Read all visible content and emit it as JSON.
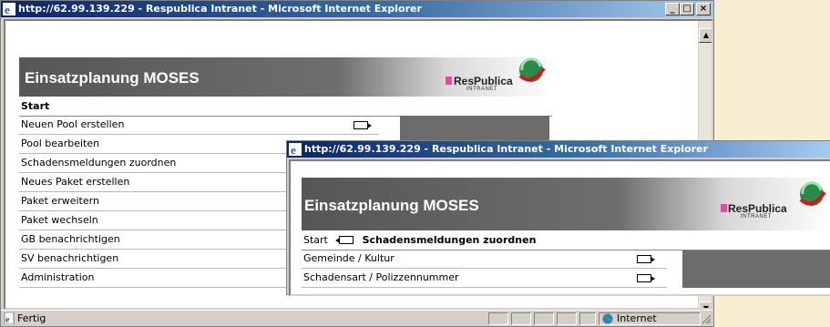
{
  "window_back": {
    "title": "http://62.99.139.229 - Respublica Intranet - Microsoft Internet Explorer",
    "controls": {
      "minimize": "_",
      "maximize": "□",
      "close": "×"
    },
    "banner_title": "Einsatzplanung MOSES",
    "logo": {
      "name": "ResPublica",
      "sub": "INTRANET"
    },
    "breadcrumb": "Start",
    "menu_items": [
      {
        "label": "Neuen Pool erstellen"
      },
      {
        "label": "Pool bearbeiten"
      },
      {
        "label": "Schadensmeldungen zuordnen"
      },
      {
        "label": "Neues Paket erstellen"
      },
      {
        "label": "Paket erweitern"
      },
      {
        "label": "Paket wechseln"
      },
      {
        "label": "GB benachrichtigen"
      },
      {
        "label": "SV benachrichtigen"
      },
      {
        "label": "Administration"
      }
    ],
    "status": {
      "text": "Fertig",
      "zone": "Internet"
    },
    "scroll": {
      "up": "▲",
      "down": "▼"
    }
  },
  "window_front": {
    "title": "http://62.99.139.229 - Respublica Intranet - Microsoft Internet Explorer",
    "banner_title": "Einsatzplanung MOSES",
    "logo": {
      "name": "ResPublica",
      "sub": "INTRANET"
    },
    "breadcrumb_start": "Start",
    "breadcrumb_current": "Schadensmeldungen zuordnen",
    "menu_items": [
      {
        "label": "Gemeinde / Kultur"
      },
      {
        "label": "Schadensart / Polizzennummer"
      }
    ]
  },
  "colors": {
    "titlebar": "#0a246a",
    "banner": "#5a5a5a",
    "logo_accent": "#e64aa0",
    "background": "#f8efd3"
  }
}
